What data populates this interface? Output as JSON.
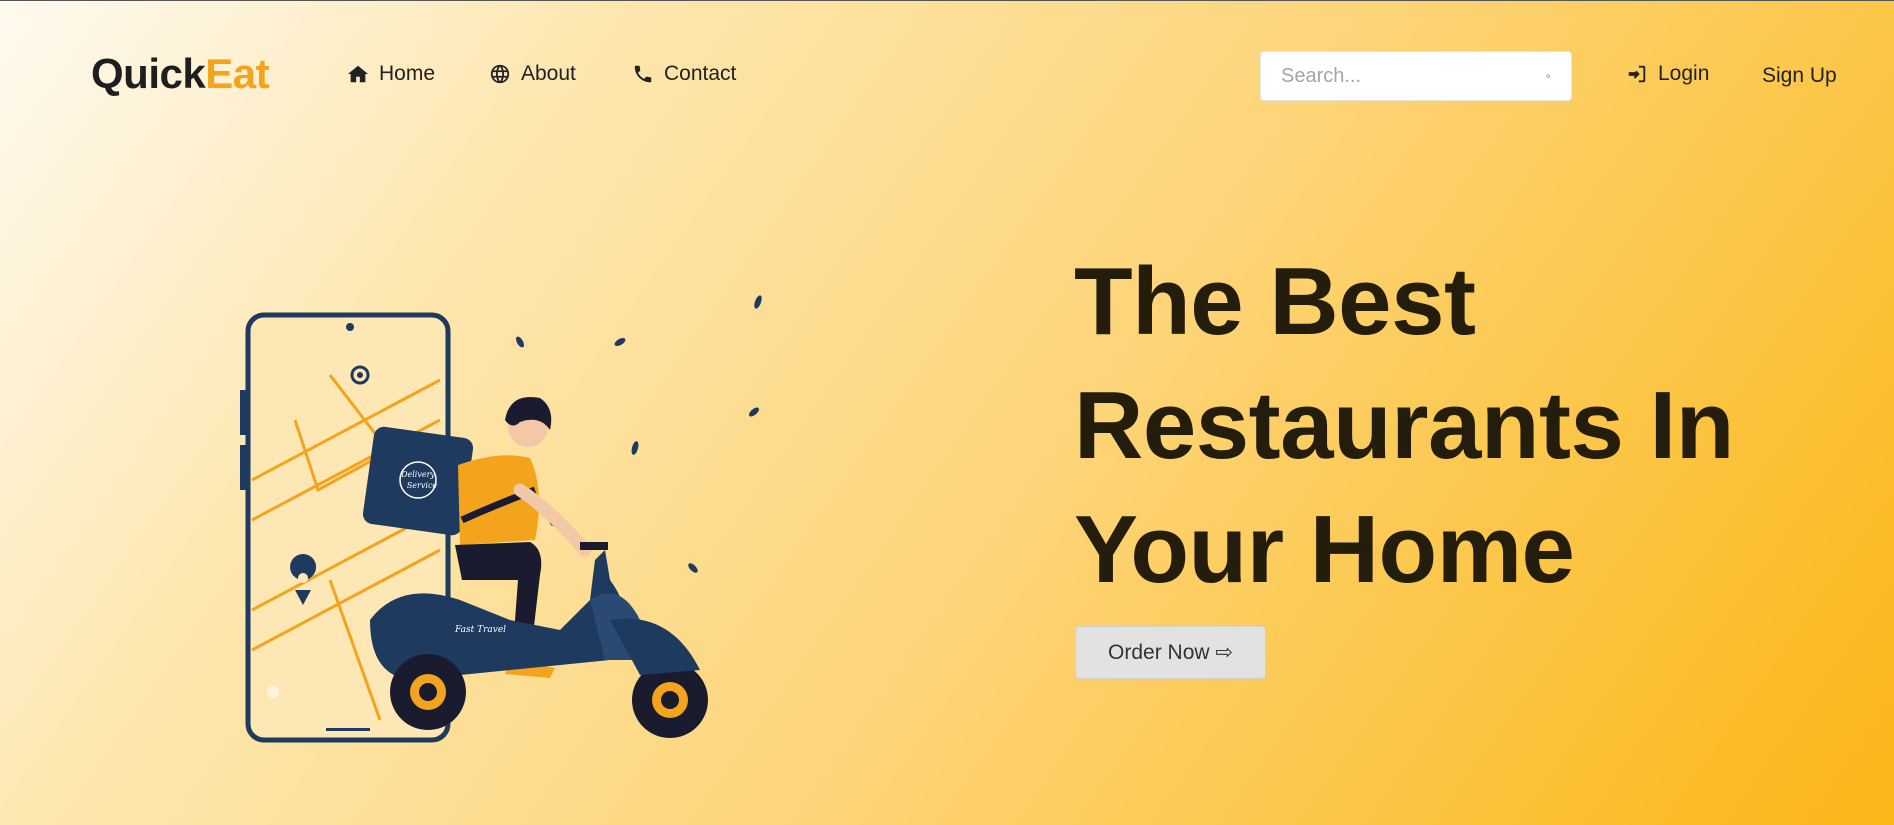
{
  "brand": {
    "part1": "Quick",
    "part2": "Eat",
    "accent_color": "#f4a41c"
  },
  "nav": {
    "items": [
      {
        "label": "Home",
        "icon": "home-icon"
      },
      {
        "label": "About",
        "icon": "globe-icon"
      },
      {
        "label": "Contact",
        "icon": "phone-icon"
      }
    ]
  },
  "search": {
    "placeholder": "Search...",
    "value": "",
    "icon": "search-icon"
  },
  "auth": {
    "login_label": "Login",
    "login_icon": "sign-in-icon",
    "signup_label": "Sign Up"
  },
  "hero": {
    "title_lines": [
      "The Best",
      "Restaurants In",
      "Your Home"
    ],
    "cta_label": "Order Now ⇨",
    "illustration": {
      "scooter_label": "Fast Travel",
      "box_label_line1": "Delivery",
      "box_label_line2": "Service"
    }
  },
  "colors": {
    "background_start": "#fffaf0",
    "background_end": "#fbb617",
    "navy": "#1e3a5f",
    "orange": "#f4a41c"
  }
}
